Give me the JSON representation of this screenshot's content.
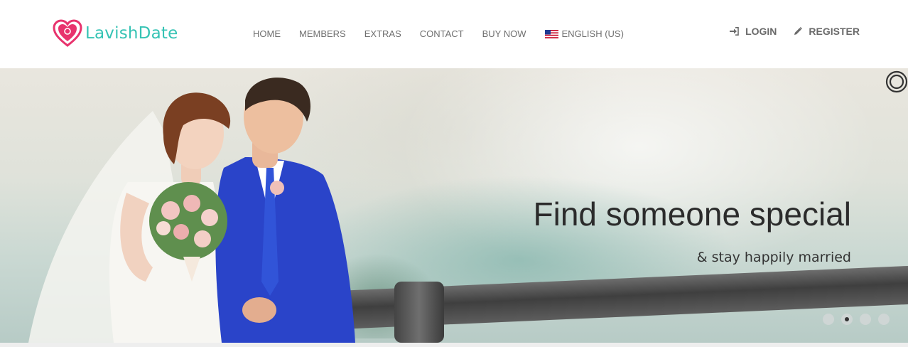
{
  "brand": {
    "name": "LavishDate",
    "color": "#35c3b4",
    "heart_color": "#e8336d"
  },
  "nav": {
    "items": [
      {
        "label": "HOME"
      },
      {
        "label": "MEMBERS"
      },
      {
        "label": "EXTRAS"
      },
      {
        "label": "CONTACT"
      },
      {
        "label": "BUY NOW"
      }
    ],
    "language": {
      "label": "ENGLISH (US)",
      "icon": "us-flag-icon"
    }
  },
  "auth": {
    "login_label": "LOGIN",
    "login_icon": "sign-in-icon",
    "register_label": "REGISTER",
    "register_icon": "pencil-icon"
  },
  "hero": {
    "title": "Find someone special",
    "subtitle": "& stay happily married",
    "slides_total": 4,
    "active_slide": 2,
    "power_icon": "power-icon"
  }
}
